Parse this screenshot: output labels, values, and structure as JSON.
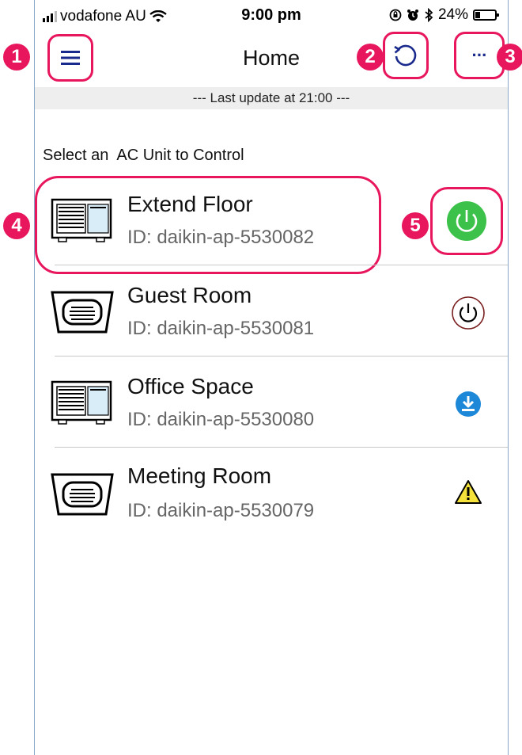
{
  "status_bar": {
    "carrier": "vodafone AU",
    "time": "9:00 pm",
    "battery": "24%",
    "battery_level": 0.24
  },
  "nav": {
    "title": "Home",
    "more_label": "···"
  },
  "update_text": "--- Last update at 21:00 ---",
  "select_label": "Select an  AC Unit to Control",
  "units": [
    {
      "name": "Extend Floor",
      "id": "ID: daikin-ap-5530082",
      "icon": "ac-unit-wall-icon",
      "status": "power-on-icon"
    },
    {
      "name": "Guest Room",
      "id": "ID: daikin-ap-5530081",
      "icon": "ac-unit-ceiling-icon",
      "status": "power-off-icon"
    },
    {
      "name": "Office Space",
      "id": "ID: daikin-ap-5530080",
      "icon": "ac-unit-wall-icon",
      "status": "download-icon"
    },
    {
      "name": "Meeting Room",
      "id": "ID: daikin-ap-5530079",
      "icon": "ac-unit-ceiling-icon",
      "status": "warning-icon"
    }
  ],
  "callouts": [
    "1",
    "2",
    "3",
    "4",
    "5"
  ],
  "colors": {
    "accent_highlight": "#e8175d",
    "nav_icon": "#1a2a8c",
    "power_on": "#3cc24a",
    "power_off": "#7a1f1f",
    "download": "#1e88d8",
    "warning": "#f5e23a"
  }
}
